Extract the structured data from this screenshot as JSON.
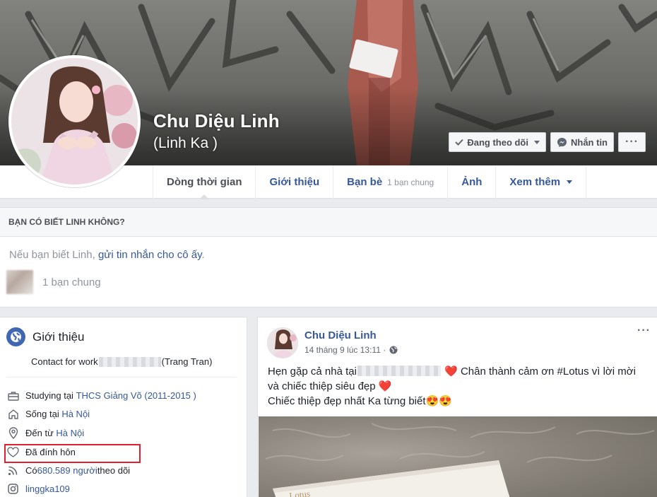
{
  "profile": {
    "name": "Chu Diệu Linh",
    "alternate_name": "(Linh Ka )"
  },
  "cover_actions": {
    "following_label": "Đang theo dõi",
    "message_label": "Nhắn tin",
    "more_label": "···"
  },
  "tabs": [
    {
      "label": "Dòng thời gian",
      "active": true
    },
    {
      "label": "Giới thiệu"
    },
    {
      "label": "Bạn bè",
      "sub": "1 bạn chung"
    },
    {
      "label": "Ảnh"
    },
    {
      "label": "Xem thêm"
    }
  ],
  "know_panel": {
    "header": "BẠN CÓ BIẾT LINH KHÔNG?",
    "prefix": "Nếu bạn biết Linh, ",
    "link": "gửi tin nhắn cho cô ấy",
    "suffix": ".",
    "mutual": "1 bạn chung"
  },
  "intro": {
    "title": "Giới thiệu",
    "contact_prefix": "Contact for work",
    "contact_suffix": "(Trang Tran)",
    "studying_prefix": "Studying tại ",
    "studying_link": "THCS Giảng Võ (2011-2015 )",
    "lives_prefix": "Sống tại ",
    "lives_link": "Hà Nội",
    "from_prefix": "Đến từ ",
    "from_link": "Hà Nội",
    "relationship": "Đã đính hôn",
    "followers_prefix": "Có ",
    "followers_link": "680.589 người",
    "followers_suffix": " theo dõi",
    "instagram": "linggka109"
  },
  "post": {
    "author": "Chu Diệu Linh",
    "timestamp": "14 tháng 9 lúc 13:11 · ",
    "more_label": "···",
    "line1_prefix": "Hẹn gặp cả nhà tại",
    "line1_suffix": " Chân thành cảm ơn #Lotus vì lời mời",
    "line2": "và chiếc thiệp siêu đẹp ",
    "line3": "Chiếc thiệp đẹp nhất Ka từng biết",
    "heart": "❤️",
    "emoji": "😍😍",
    "card_text": "Lotus"
  },
  "colors": {
    "link": "#365899",
    "accent": "#4267b2",
    "highlight_box": "#e0202e"
  }
}
